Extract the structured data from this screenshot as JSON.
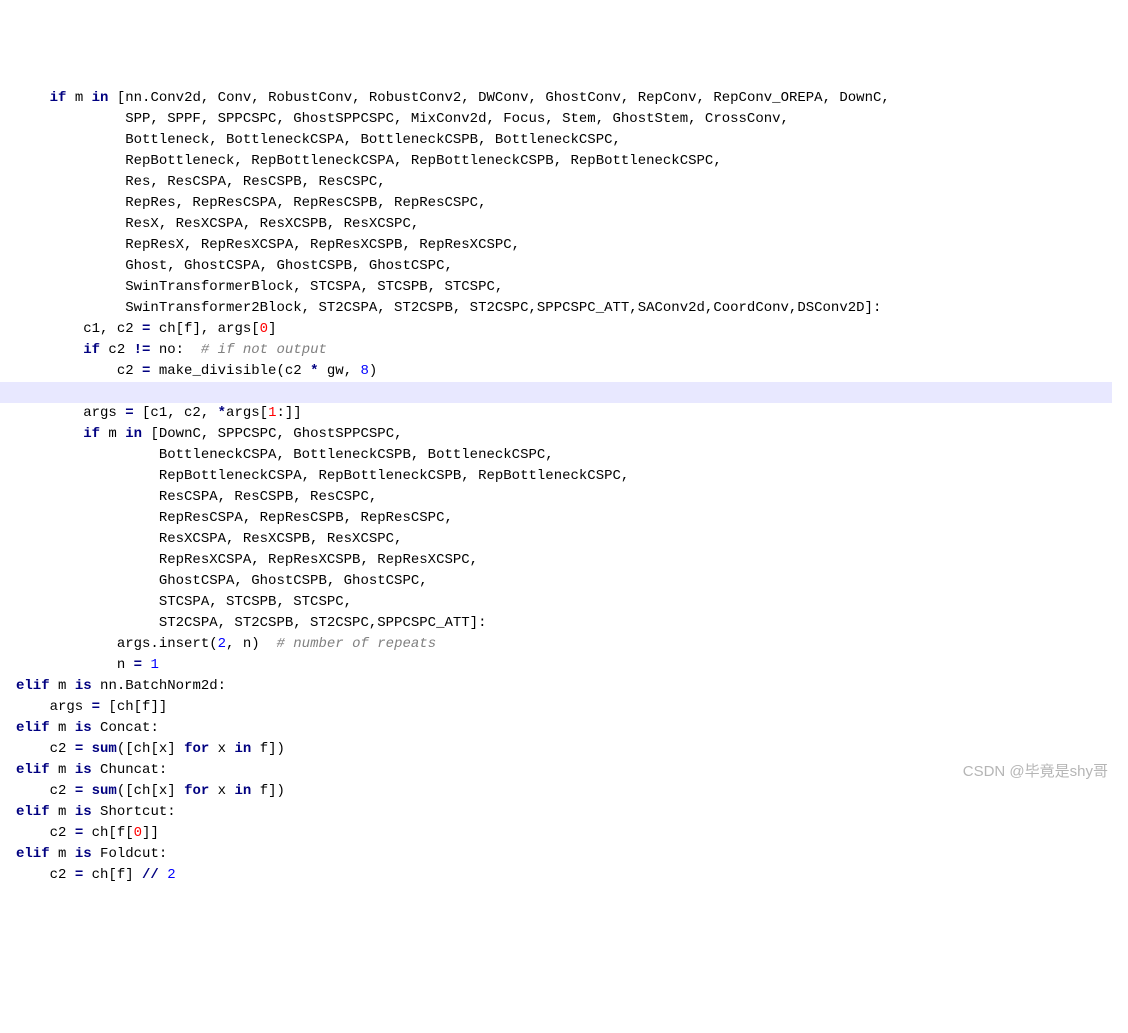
{
  "code": {
    "lines": [
      {
        "indent": 0,
        "tokens": [
          {
            "t": "kw",
            "v": "if"
          },
          {
            "t": "txt",
            "v": " m "
          },
          {
            "t": "kw",
            "v": "in"
          },
          {
            "t": "txt",
            "v": " [nn.Conv2d, Conv, RobustConv, RobustConv2, DWConv, GhostConv, RepConv, RepConv_OREPA, DownC,"
          }
        ]
      },
      {
        "indent": 0,
        "tokens": [
          {
            "t": "txt",
            "v": "         SPP, SPPF, SPPCSPC, GhostSPPCSPC, MixConv2d, Focus, Stem, GhostStem, CrossConv,"
          }
        ]
      },
      {
        "indent": 0,
        "tokens": [
          {
            "t": "txt",
            "v": "         Bottleneck, BottleneckCSPA, BottleneckCSPB, BottleneckCSPC,"
          }
        ]
      },
      {
        "indent": 0,
        "tokens": [
          {
            "t": "txt",
            "v": "         RepBottleneck, RepBottleneckCSPA, RepBottleneckCSPB, RepBottleneckCSPC,"
          }
        ]
      },
      {
        "indent": 0,
        "tokens": [
          {
            "t": "txt",
            "v": "         Res, ResCSPA, ResCSPB, ResCSPC,"
          }
        ]
      },
      {
        "indent": 0,
        "tokens": [
          {
            "t": "txt",
            "v": "         RepRes, RepResCSPA, RepResCSPB, RepResCSPC,"
          }
        ]
      },
      {
        "indent": 0,
        "tokens": [
          {
            "t": "txt",
            "v": "         ResX, ResXCSPA, ResXCSPB, ResXCSPC,"
          }
        ]
      },
      {
        "indent": 0,
        "tokens": [
          {
            "t": "txt",
            "v": "         RepResX, RepResXCSPA, RepResXCSPB, RepResXCSPC,"
          }
        ]
      },
      {
        "indent": 0,
        "tokens": [
          {
            "t": "txt",
            "v": "         Ghost, GhostCSPA, GhostCSPB, GhostCSPC,"
          }
        ]
      },
      {
        "indent": 0,
        "tokens": [
          {
            "t": "txt",
            "v": "         SwinTransformerBlock, STCSPA, STCSPB, STCSPC,"
          }
        ]
      },
      {
        "indent": 0,
        "tokens": [
          {
            "t": "txt",
            "v": "         SwinTransformer2Block, ST2CSPA, ST2CSPB, ST2CSPC,SPPCSPC_ATT,SAConv2d,CoordConv,DSConv2D]:"
          }
        ]
      },
      {
        "indent": 1,
        "tokens": [
          {
            "t": "txt",
            "v": "c1, c2 "
          },
          {
            "t": "op",
            "v": "="
          },
          {
            "t": "txt",
            "v": " ch[f], args["
          },
          {
            "t": "red",
            "v": "0"
          },
          {
            "t": "txt",
            "v": "]"
          }
        ]
      },
      {
        "indent": 1,
        "tokens": [
          {
            "t": "kw",
            "v": "if"
          },
          {
            "t": "txt",
            "v": " c2 "
          },
          {
            "t": "op",
            "v": "!="
          },
          {
            "t": "txt",
            "v": " no:  "
          },
          {
            "t": "cmt",
            "v": "# if not output"
          }
        ]
      },
      {
        "indent": 2,
        "tokens": [
          {
            "t": "txt",
            "v": "c2 "
          },
          {
            "t": "op",
            "v": "="
          },
          {
            "t": "txt",
            "v": " make_divisible(c2 "
          },
          {
            "t": "op",
            "v": "*"
          },
          {
            "t": "txt",
            "v": " gw, "
          },
          {
            "t": "num",
            "v": "8"
          },
          {
            "t": "txt",
            "v": ")"
          }
        ]
      },
      {
        "indent": 0,
        "hl": true,
        "tokens": [
          {
            "t": "txt",
            "v": ""
          }
        ]
      },
      {
        "indent": 1,
        "tokens": [
          {
            "t": "txt",
            "v": "args "
          },
          {
            "t": "op",
            "v": "="
          },
          {
            "t": "txt",
            "v": " [c1, c2, "
          },
          {
            "t": "op",
            "v": "*"
          },
          {
            "t": "txt",
            "v": "args["
          },
          {
            "t": "red",
            "v": "1"
          },
          {
            "t": "txt",
            "v": ":]]"
          }
        ]
      },
      {
        "indent": 1,
        "tokens": [
          {
            "t": "kw",
            "v": "if"
          },
          {
            "t": "txt",
            "v": " m "
          },
          {
            "t": "kw",
            "v": "in"
          },
          {
            "t": "txt",
            "v": " [DownC, SPPCSPC, GhostSPPCSPC,"
          }
        ]
      },
      {
        "indent": 1,
        "tokens": [
          {
            "t": "txt",
            "v": "         BottleneckCSPA, BottleneckCSPB, BottleneckCSPC,"
          }
        ]
      },
      {
        "indent": 1,
        "tokens": [
          {
            "t": "txt",
            "v": "         RepBottleneckCSPA, RepBottleneckCSPB, RepBottleneckCSPC,"
          }
        ]
      },
      {
        "indent": 1,
        "tokens": [
          {
            "t": "txt",
            "v": "         ResCSPA, ResCSPB, ResCSPC,"
          }
        ]
      },
      {
        "indent": 1,
        "tokens": [
          {
            "t": "txt",
            "v": "         RepResCSPA, RepResCSPB, RepResCSPC,"
          }
        ]
      },
      {
        "indent": 1,
        "tokens": [
          {
            "t": "txt",
            "v": "         ResXCSPA, ResXCSPB, ResXCSPC,"
          }
        ]
      },
      {
        "indent": 1,
        "tokens": [
          {
            "t": "txt",
            "v": "         RepResXCSPA, RepResXCSPB, RepResXCSPC,"
          }
        ]
      },
      {
        "indent": 1,
        "tokens": [
          {
            "t": "txt",
            "v": "         GhostCSPA, GhostCSPB, GhostCSPC,"
          }
        ]
      },
      {
        "indent": 1,
        "tokens": [
          {
            "t": "txt",
            "v": "         STCSPA, STCSPB, STCSPC,"
          }
        ]
      },
      {
        "indent": 1,
        "tokens": [
          {
            "t": "txt",
            "v": "         ST2CSPA, ST2CSPB, ST2CSPC,SPPCSPC_ATT]:"
          }
        ]
      },
      {
        "indent": 2,
        "tokens": [
          {
            "t": "txt",
            "v": "args.insert("
          },
          {
            "t": "num",
            "v": "2"
          },
          {
            "t": "txt",
            "v": ", n)  "
          },
          {
            "t": "cmt",
            "v": "# number of repeats"
          }
        ]
      },
      {
        "indent": 2,
        "tokens": [
          {
            "t": "txt",
            "v": "n "
          },
          {
            "t": "op",
            "v": "="
          },
          {
            "t": "txt",
            "v": " "
          },
          {
            "t": "num",
            "v": "1"
          }
        ]
      },
      {
        "indent": 0,
        "elif": true,
        "tokens": [
          {
            "t": "kw",
            "v": "elif"
          },
          {
            "t": "txt",
            "v": " m "
          },
          {
            "t": "kw",
            "v": "is"
          },
          {
            "t": "txt",
            "v": " nn.BatchNorm2d:"
          }
        ],
        "elifStart": true
      },
      {
        "indent": 1,
        "tokens": [
          {
            "t": "txt",
            "v": "args "
          },
          {
            "t": "op",
            "v": "="
          },
          {
            "t": "txt",
            "v": " [ch[f]]"
          }
        ]
      },
      {
        "indent": 0,
        "tokens": [
          {
            "t": "kw",
            "v": "elif"
          },
          {
            "t": "txt",
            "v": " m "
          },
          {
            "t": "kw",
            "v": "is"
          },
          {
            "t": "txt",
            "v": " Concat:"
          }
        ],
        "elifStart": true
      },
      {
        "indent": 1,
        "tokens": [
          {
            "t": "txt",
            "v": "c2 "
          },
          {
            "t": "op",
            "v": "="
          },
          {
            "t": "txt",
            "v": " "
          },
          {
            "t": "fn",
            "v": "sum"
          },
          {
            "t": "txt",
            "v": "([ch[x] "
          },
          {
            "t": "kw",
            "v": "for"
          },
          {
            "t": "txt",
            "v": " x "
          },
          {
            "t": "kw",
            "v": "in"
          },
          {
            "t": "txt",
            "v": " f])"
          }
        ]
      },
      {
        "indent": 0,
        "tokens": [
          {
            "t": "kw",
            "v": "elif"
          },
          {
            "t": "txt",
            "v": " m "
          },
          {
            "t": "kw",
            "v": "is"
          },
          {
            "t": "txt",
            "v": " Chuncat:"
          }
        ],
        "elifStart": true
      },
      {
        "indent": 1,
        "tokens": [
          {
            "t": "txt",
            "v": "c2 "
          },
          {
            "t": "op",
            "v": "="
          },
          {
            "t": "txt",
            "v": " "
          },
          {
            "t": "fn",
            "v": "sum"
          },
          {
            "t": "txt",
            "v": "([ch[x] "
          },
          {
            "t": "kw",
            "v": "for"
          },
          {
            "t": "txt",
            "v": " x "
          },
          {
            "t": "kw",
            "v": "in"
          },
          {
            "t": "txt",
            "v": " f])"
          }
        ]
      },
      {
        "indent": 0,
        "tokens": [
          {
            "t": "kw",
            "v": "elif"
          },
          {
            "t": "txt",
            "v": " m "
          },
          {
            "t": "kw",
            "v": "is"
          },
          {
            "t": "txt",
            "v": " Shortcut:"
          }
        ],
        "elifStart": true
      },
      {
        "indent": 1,
        "tokens": [
          {
            "t": "txt",
            "v": "c2 "
          },
          {
            "t": "op",
            "v": "="
          },
          {
            "t": "txt",
            "v": " ch[f["
          },
          {
            "t": "red",
            "v": "0"
          },
          {
            "t": "txt",
            "v": "]]"
          }
        ]
      },
      {
        "indent": 0,
        "tokens": [
          {
            "t": "kw",
            "v": "elif"
          },
          {
            "t": "txt",
            "v": " m "
          },
          {
            "t": "kw",
            "v": "is"
          },
          {
            "t": "txt",
            "v": " Foldcut:"
          }
        ],
        "elifStart": true
      },
      {
        "indent": 1,
        "tokens": [
          {
            "t": "txt",
            "v": "c2 "
          },
          {
            "t": "op",
            "v": "="
          },
          {
            "t": "txt",
            "v": " ch[f] "
          },
          {
            "t": "op",
            "v": "//"
          },
          {
            "t": "txt",
            "v": " "
          },
          {
            "t": "num",
            "v": "2"
          }
        ]
      }
    ]
  },
  "watermark": "CSDN @毕竟是shy哥"
}
